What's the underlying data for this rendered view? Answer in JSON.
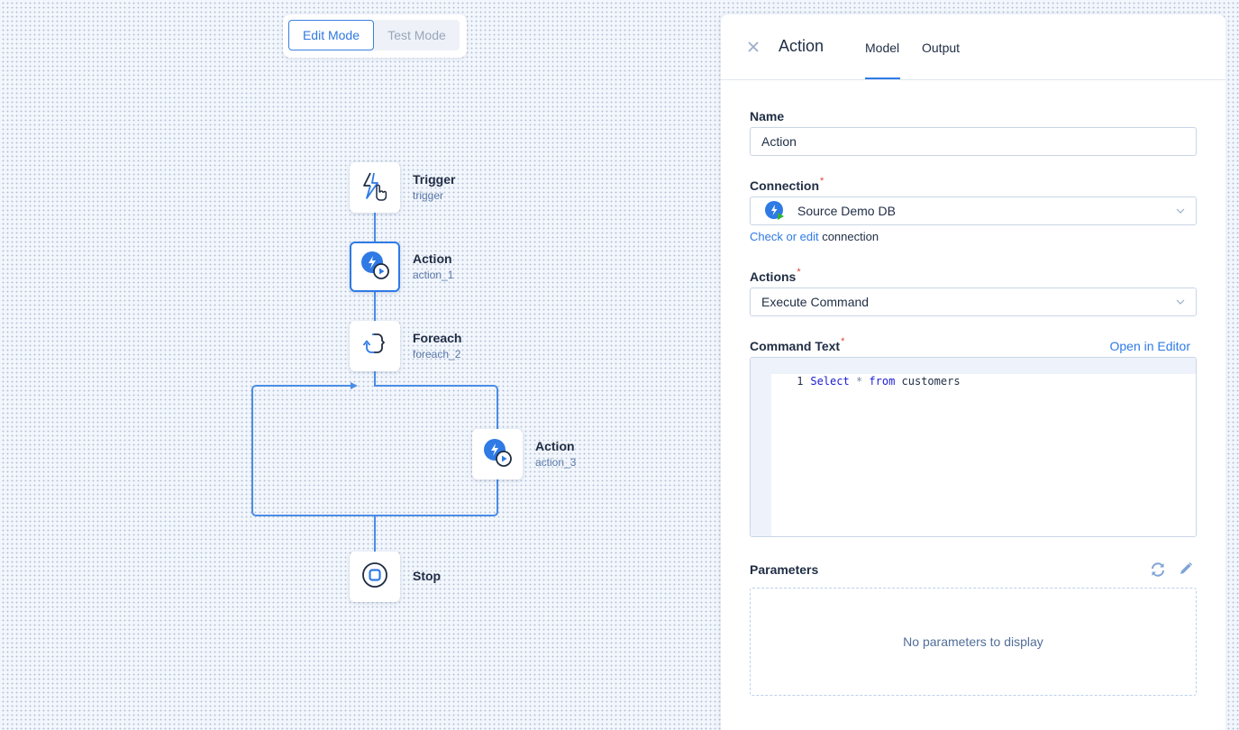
{
  "mode_switch": {
    "edit_label": "Edit Mode",
    "test_label": "Test Mode",
    "active": "edit"
  },
  "colors": {
    "accent": "#2f7ae5",
    "connector": "#4a8de6",
    "required": "#e0443c",
    "dark_icon": "#1f2d44"
  },
  "flow": {
    "nodes": [
      {
        "id": "trigger",
        "title": "Trigger",
        "subtitle": "trigger",
        "icon": "trigger-bolt-hand-icon",
        "selected": false
      },
      {
        "id": "action_1",
        "title": "Action",
        "subtitle": "action_1",
        "icon": "action-bolt-play-icon",
        "selected": true
      },
      {
        "id": "foreach_2",
        "title": "Foreach",
        "subtitle": "foreach_2",
        "icon": "foreach-loop-icon",
        "selected": false
      },
      {
        "id": "action_3",
        "title": "Action",
        "subtitle": "action_3",
        "icon": "action-bolt-play-icon",
        "selected": false
      },
      {
        "id": "stop",
        "title": "Stop",
        "subtitle": "",
        "icon": "stop-icon",
        "selected": false
      }
    ]
  },
  "panel": {
    "title": "Action",
    "close_icon": "close-icon",
    "tabs": [
      {
        "label": "Model",
        "active": true
      },
      {
        "label": "Output",
        "active": false
      }
    ],
    "fields": {
      "name": {
        "label": "Name",
        "value": "Action",
        "required": false
      },
      "connection": {
        "label": "Connection",
        "required": true,
        "value": "Source Demo DB",
        "icon": "database-connection-icon",
        "helper_link": "Check or edit",
        "helper_text": " connection"
      },
      "actions": {
        "label": "Actions",
        "required": true,
        "value": "Execute Command"
      },
      "command_text": {
        "label": "Command Text",
        "required": true,
        "open_editor_label": "Open in Editor",
        "lines": [
          {
            "number": "1",
            "tokens": [
              {
                "text": "Select",
                "kind": "kw"
              },
              {
                "text": " * ",
                "kind": "op"
              },
              {
                "text": "from",
                "kind": "kw"
              },
              {
                "text": " customers",
                "kind": "id"
              }
            ]
          }
        ]
      },
      "parameters": {
        "label": "Parameters",
        "empty_text": "No parameters to display",
        "actions": [
          "refresh-icon",
          "edit-pencil-icon"
        ]
      }
    },
    "required_mark": "*"
  }
}
